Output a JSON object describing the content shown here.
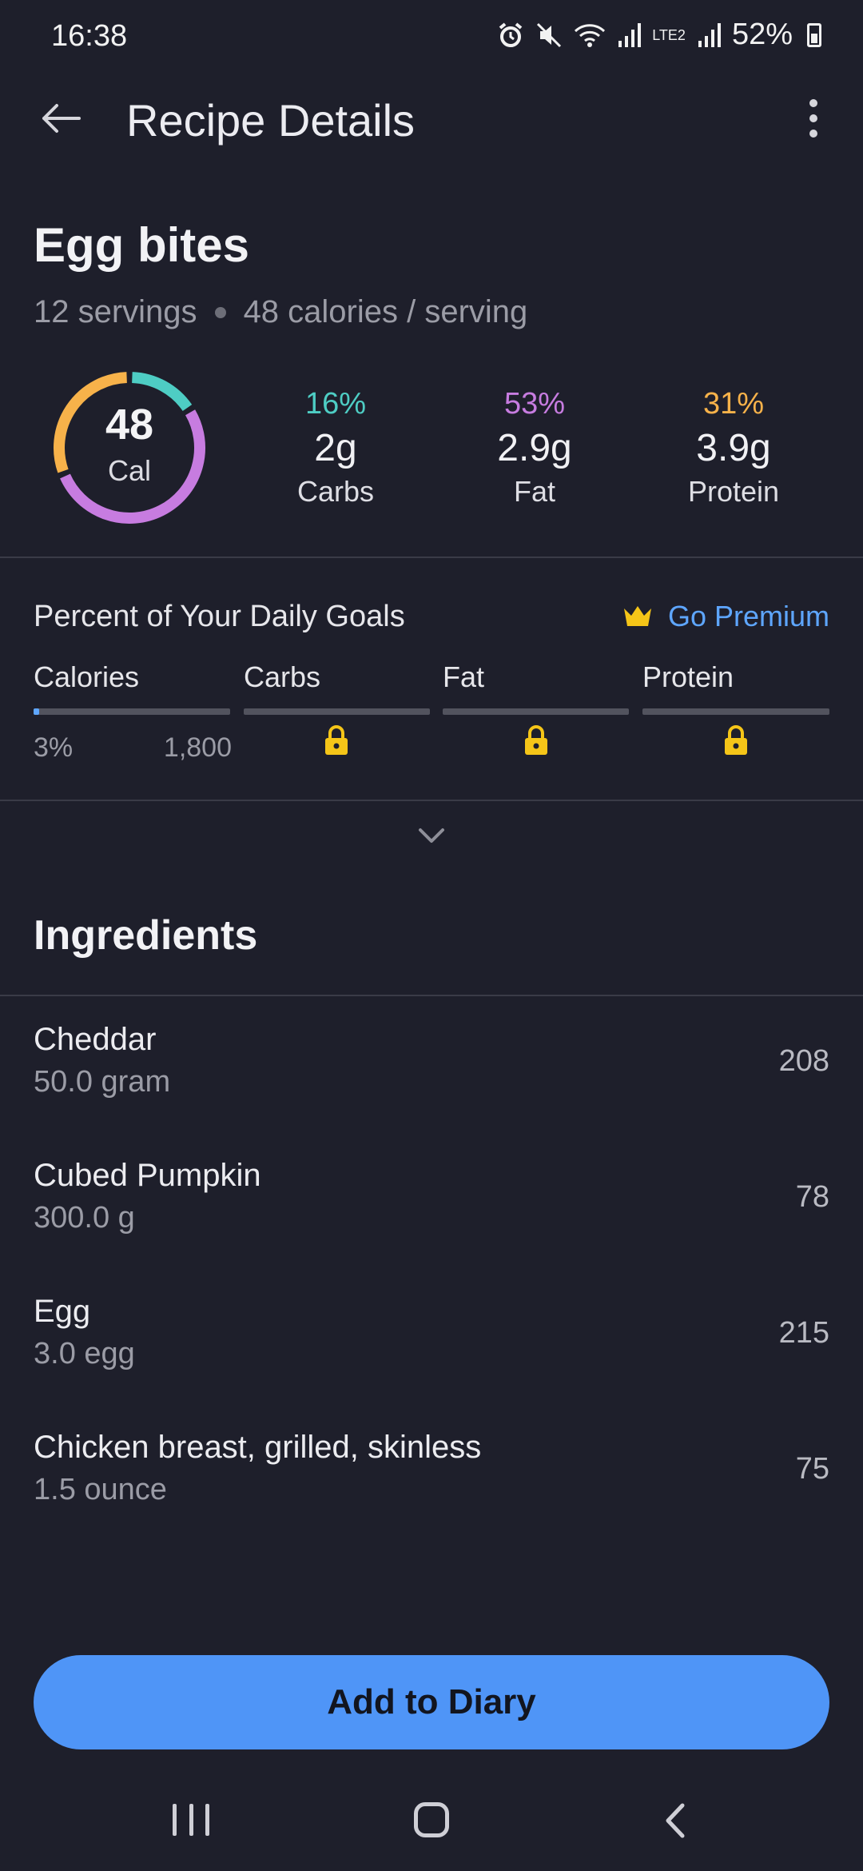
{
  "status_bar": {
    "time": "16:38",
    "battery": "52%",
    "network": "LTE2"
  },
  "app_bar": {
    "title": "Recipe Details"
  },
  "recipe": {
    "name": "Egg bites",
    "servings": "12 servings",
    "calories_per_serving": "48 calories / serving",
    "calories": "48",
    "calories_unit": "Cal"
  },
  "macros": [
    {
      "percent": "16%",
      "amount": "2g",
      "label": "Carbs",
      "color": "#4ecdc4"
    },
    {
      "percent": "53%",
      "amount": "2.9g",
      "label": "Fat",
      "color": "#c77ce0"
    },
    {
      "percent": "31%",
      "amount": "3.9g",
      "label": "Protein",
      "color": "#f7b24a"
    }
  ],
  "daily_goals": {
    "title": "Percent of Your Daily Goals",
    "premium_label": "Go Premium",
    "columns": [
      {
        "label": "Calories",
        "progress": 0.03,
        "locked": false
      },
      {
        "label": "Carbs",
        "locked": true
      },
      {
        "label": "Fat",
        "locked": true
      },
      {
        "label": "Protein",
        "locked": true
      }
    ],
    "calories_percent": "3%",
    "calories_goal": "1,800"
  },
  "ingredients": {
    "title": "Ingredients",
    "items": [
      {
        "name": "Cheddar",
        "quantity": "50.0 gram",
        "calories": "208"
      },
      {
        "name": "Cubed Pumpkin",
        "quantity": "300.0 g",
        "calories": "78"
      },
      {
        "name": "Egg",
        "quantity": "3.0 egg",
        "calories": "215"
      },
      {
        "name": "Chicken breast, grilled, skinless",
        "quantity": "1.5 ounce",
        "calories": "75"
      }
    ]
  },
  "actions": {
    "add_to_diary": "Add to Diary"
  },
  "colors": {
    "background": "#1e1f2b",
    "accent": "#4f95f7",
    "lock": "#f5c518"
  }
}
